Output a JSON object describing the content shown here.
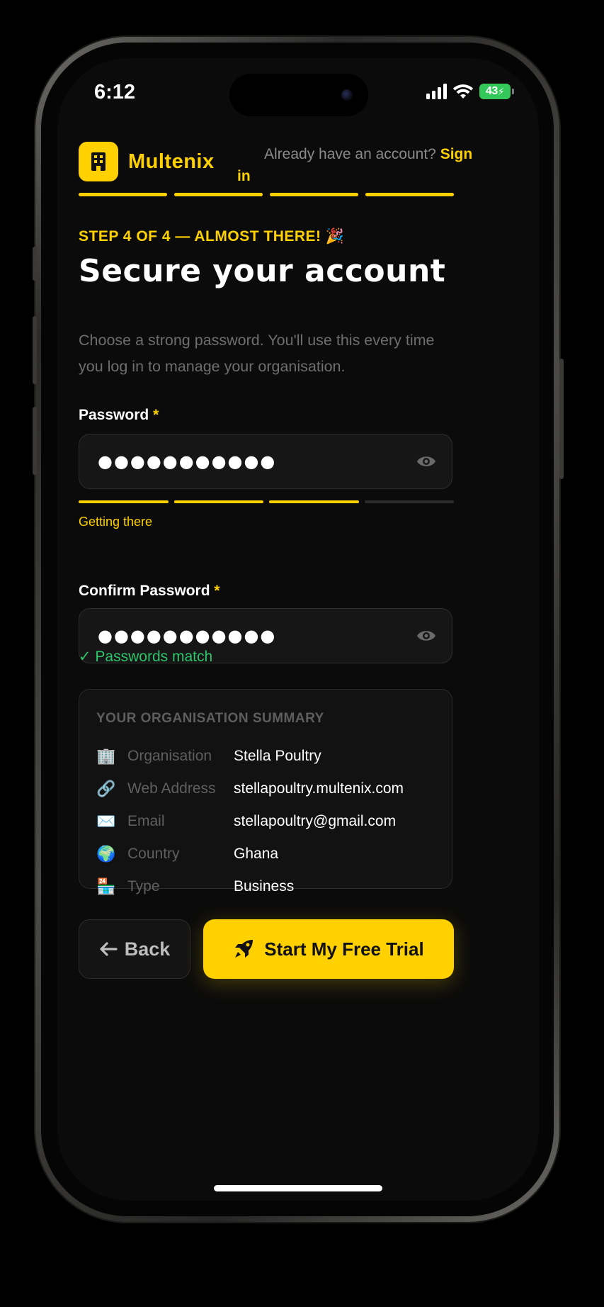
{
  "status_bar": {
    "time": "6:12",
    "battery": "43"
  },
  "brand": {
    "name": "Multenix"
  },
  "header": {
    "signin_prompt": "Already have an account?",
    "signin_link": "Sign",
    "signin_link_wrap": "in"
  },
  "progress": {
    "current_step": 4,
    "total_steps": 4
  },
  "step_label": "STEP 4 OF 4 — ALMOST THERE! 🎉",
  "title": "Secure your account",
  "subtitle": "Choose a strong password. You'll use this every time you log in to manage your organisation.",
  "password": {
    "label": "Password",
    "required_mark": "*",
    "masked_value": "●●●●●●●●●●●",
    "strength_level": 3,
    "strength_max": 4,
    "strength_text": "Getting there"
  },
  "confirm_password": {
    "label": "Confirm Password",
    "required_mark": "*",
    "masked_value": "●●●●●●●●●●●",
    "match_text": "✓ Passwords match"
  },
  "summary": {
    "title": "YOUR ORGANISATION SUMMARY",
    "rows": [
      {
        "icon": "🏢",
        "icon_name": "office-building-icon",
        "key": "Organisation",
        "value": "Stella Poultry"
      },
      {
        "icon": "🔗",
        "icon_name": "link-icon",
        "key": "Web Address",
        "value": "stellapoultry.multenix.com"
      },
      {
        "icon": "✉️",
        "icon_name": "envelope-icon",
        "key": "Email",
        "value": "stellapoultry@gmail.com"
      },
      {
        "icon": "🌍",
        "icon_name": "globe-icon",
        "key": "Country",
        "value": "Ghana"
      },
      {
        "icon": "🏪",
        "icon_name": "store-icon",
        "key": "Type",
        "value": "Business"
      }
    ]
  },
  "actions": {
    "back_label": "Back",
    "primary_label": "Start My Free Trial"
  },
  "colors": {
    "accent": "#ffd100",
    "success": "#2ec46b",
    "background": "#0b0b0b"
  }
}
